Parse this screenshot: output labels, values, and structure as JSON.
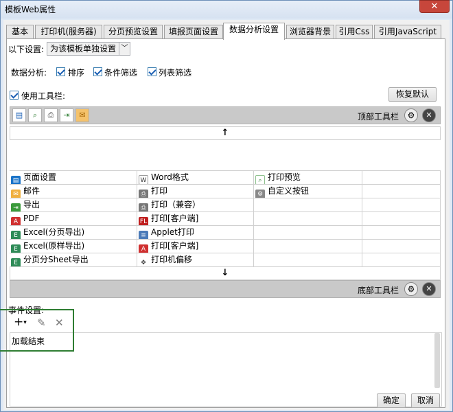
{
  "window": {
    "title": "模板Web属性",
    "close_glyph": "✕"
  },
  "tabs": [
    "基本",
    "打印机(服务器)",
    "分页预览设置",
    "填报页面设置",
    "数据分析设置",
    "浏览器背景",
    "引用Css",
    "引用JavaScript"
  ],
  "settings": {
    "mode_label": "以下设置:",
    "mode_value": "为该模板单独设置",
    "analysis_label": "数据分析:",
    "sort_label": "排序",
    "filter_label": "条件筛选",
    "list_filter_label": "列表筛选",
    "use_toolbar_label": "使用工具栏:",
    "restore_default": "恢复默认"
  },
  "top_toolbar": {
    "label": "顶部工具栏",
    "move_glyph": "↑"
  },
  "bottom_toolbar": {
    "label": "底部工具栏",
    "move_glyph": "↓"
  },
  "toolbar_items": {
    "col1": [
      "页面设置",
      "邮件",
      "导出",
      "PDF",
      "Excel(分页导出)",
      "Excel(原样导出)",
      "分页分Sheet导出"
    ],
    "col2": [
      "Word格式",
      "打印",
      "打印（兼容）",
      "打印[客户端]",
      "Applet打印",
      "打印[客户端]",
      "打印机偏移"
    ],
    "col3": [
      "打印预览",
      "自定义按钮"
    ]
  },
  "events": {
    "label": "事件设置:",
    "items": [
      "加载结束"
    ]
  },
  "footer": {
    "ok": "确定",
    "cancel": "取消"
  },
  "colors": {
    "accent": "#1a5fb4",
    "highlight_box": "#2e7d32"
  }
}
